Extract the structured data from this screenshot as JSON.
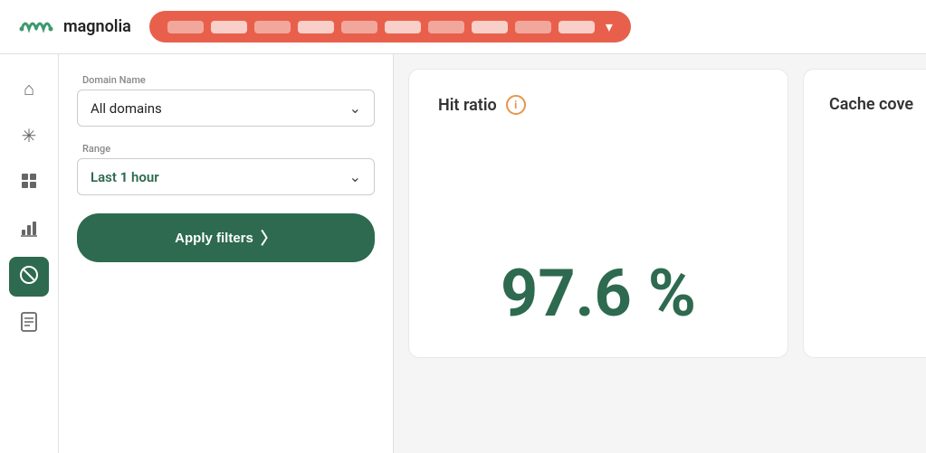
{
  "navbar": {
    "logo_text": "magnolia",
    "pill": {
      "items_count": 10,
      "chevron": "▾"
    }
  },
  "sidebar": {
    "items": [
      {
        "id": "home",
        "icon": "⌂",
        "active": false
      },
      {
        "id": "asterisk",
        "icon": "✳",
        "active": false
      },
      {
        "id": "grid",
        "icon": "⊞",
        "active": false
      },
      {
        "id": "chart",
        "icon": "⊤",
        "active": false
      },
      {
        "id": "block",
        "icon": "⊘",
        "active": true
      },
      {
        "id": "doc",
        "icon": "⊡",
        "active": false
      }
    ]
  },
  "filters": {
    "domain_label": "Domain Name",
    "domain_value": "All domains",
    "range_label": "Range",
    "range_prefix": "Last ",
    "range_number": "1",
    "range_suffix": " hour",
    "apply_label": "Apply filters"
  },
  "metrics": {
    "hit_ratio": {
      "title": "Hit ratio",
      "value": "97.6 %",
      "info": "i"
    },
    "cache_coverage": {
      "title": "Cache cove"
    }
  }
}
